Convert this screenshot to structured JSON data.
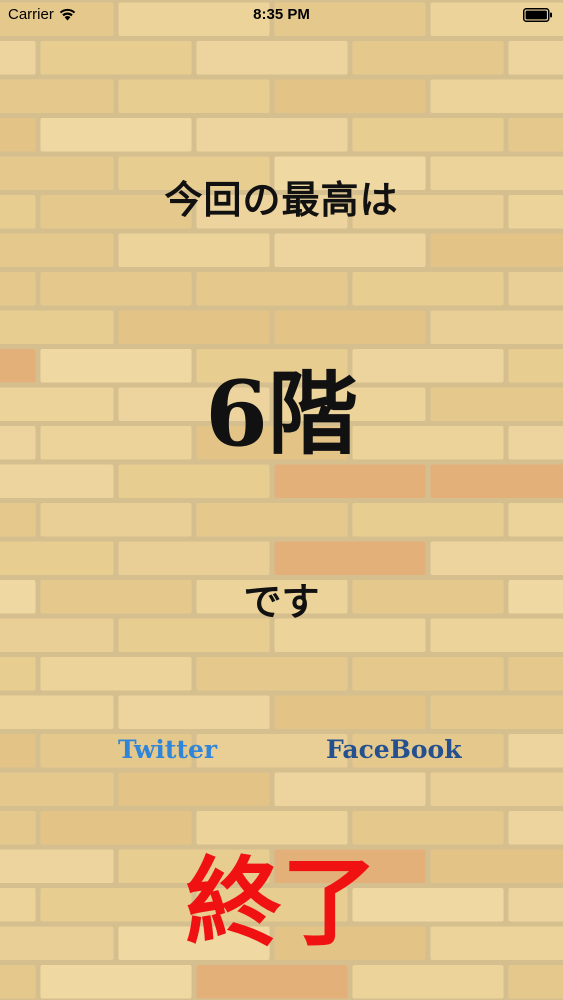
{
  "status_bar": {
    "carrier": "Carrier",
    "time": "8:35 PM",
    "wifi_icon": "wifi-icon",
    "battery_icon": "battery-icon"
  },
  "result": {
    "heading": "今回の最高は",
    "floor": "6階",
    "suffix": "です"
  },
  "share": {
    "twitter_label": "Twitter",
    "facebook_label": "FaceBook"
  },
  "actions": {
    "finish_label": "終了"
  },
  "colors": {
    "background_brick": "#e9cf96",
    "mortar": "#d6bf8f",
    "text": "#111111",
    "twitter": "#2f86d8",
    "facebook": "#24508f",
    "finish": "#f01212"
  }
}
